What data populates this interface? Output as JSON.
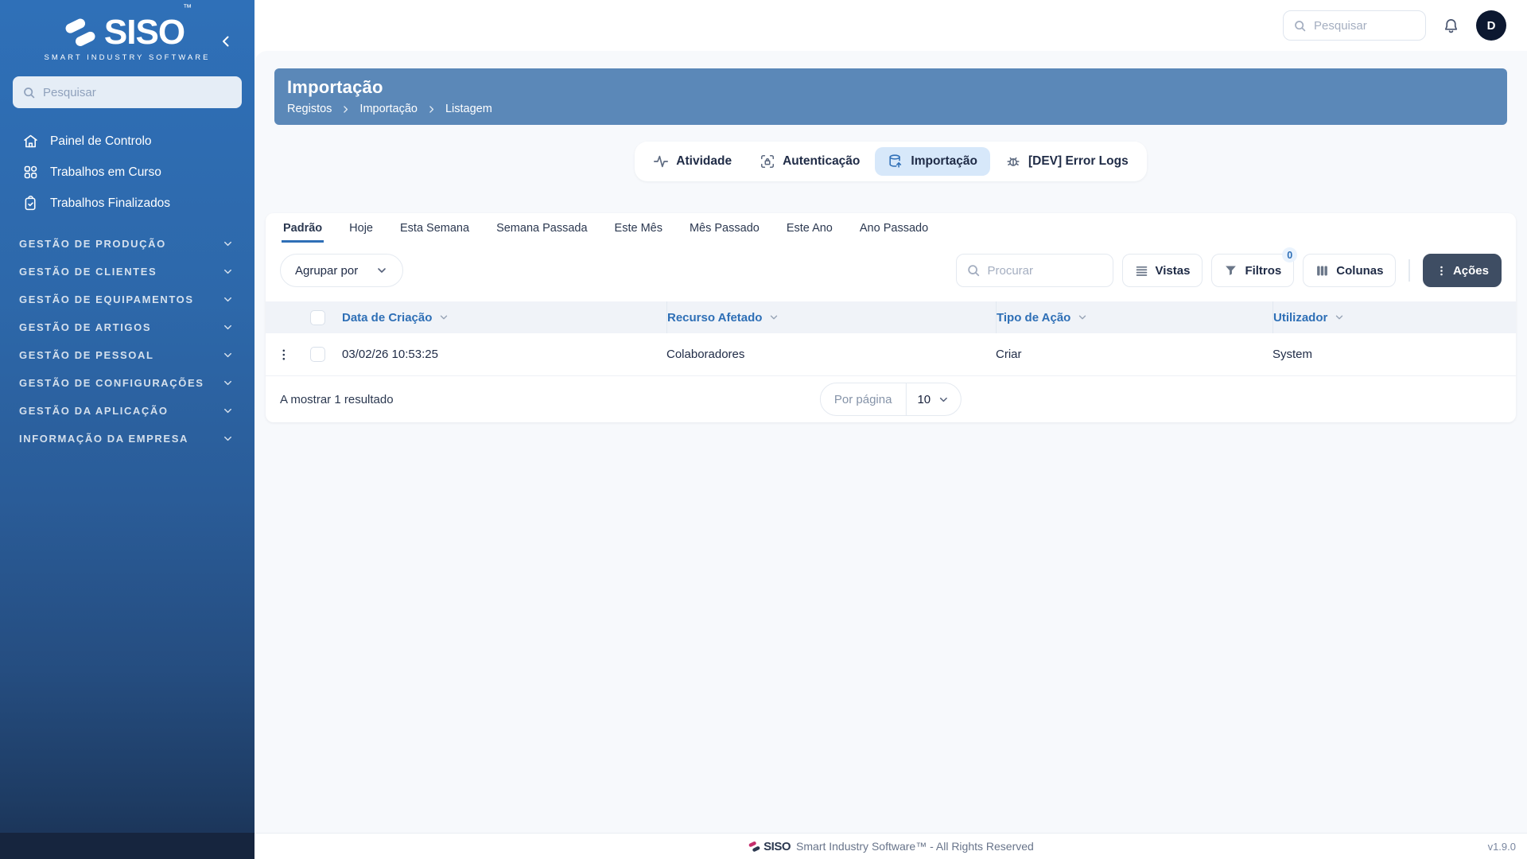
{
  "app": {
    "brand": "SISO",
    "trademark": "™",
    "brand_tagline": "SMART INDUSTRY SOFTWARE",
    "footer_text": "Smart Industry Software™ - All Rights Reserved",
    "version": "v1.9.0"
  },
  "sidebar": {
    "search_placeholder": "Pesquisar",
    "items": [
      {
        "icon": "home-icon",
        "label": "Painel de Controlo"
      },
      {
        "icon": "grid-icon",
        "label": "Trabalhos em Curso"
      },
      {
        "icon": "clipboard-check-icon",
        "label": "Trabalhos Finalizados"
      }
    ],
    "sections": [
      "GESTÃO DE PRODUÇÃO",
      "GESTÃO DE CLIENTES",
      "GESTÃO DE EQUIPAMENTOS",
      "GESTÃO DE ARTIGOS",
      "GESTÃO DE PESSOAL",
      "GESTÃO DE CONFIGURAÇÕES",
      "GESTÃO DA APLICAÇÃO",
      "INFORMAÇÃO DA EMPRESA"
    ]
  },
  "topbar": {
    "search_placeholder": "Pesquisar",
    "avatar_initial": "D"
  },
  "page": {
    "title": "Importação",
    "breadcrumbs": [
      "Registos",
      "Importação",
      "Listagem"
    ]
  },
  "tabs": [
    {
      "icon": "activity-icon",
      "label": "Atividade"
    },
    {
      "icon": "auth-scan-icon",
      "label": "Autenticação"
    },
    {
      "icon": "database-import-icon",
      "label": "Importação"
    },
    {
      "icon": "bug-icon",
      "label": "[DEV] Error Logs"
    }
  ],
  "filters": {
    "tabs": [
      "Padrão",
      "Hoje",
      "Esta Semana",
      "Semana Passada",
      "Este Mês",
      "Mês Passado",
      "Este Ano",
      "Ano Passado"
    ],
    "active": "Padrão"
  },
  "toolbar": {
    "group_by_label": "Agrupar por",
    "search_placeholder": "Procurar",
    "views_label": "Vistas",
    "filters_label": "Filtros",
    "filters_count": "0",
    "columns_label": "Colunas",
    "actions_label": "Ações"
  },
  "table": {
    "headers": [
      "Data de Criação",
      "Recurso Afetado",
      "Tipo de Ação",
      "Utilizador"
    ],
    "rows": [
      [
        "03/02/26 10:53:25",
        "Colaboradores",
        "Criar",
        "System"
      ]
    ],
    "footer": {
      "results_text": "A mostrar 1 resultado",
      "per_page_label": "Por página",
      "per_page_value": "10"
    }
  },
  "colors": {
    "accent": "#2f6fb7",
    "banner": "#5b88b8",
    "active_tab_bg": "#d7e8fa",
    "actions_button": "#3e4d63",
    "sidebar_top": "#2f70b8",
    "sidebar_bottom": "#1a3153"
  }
}
